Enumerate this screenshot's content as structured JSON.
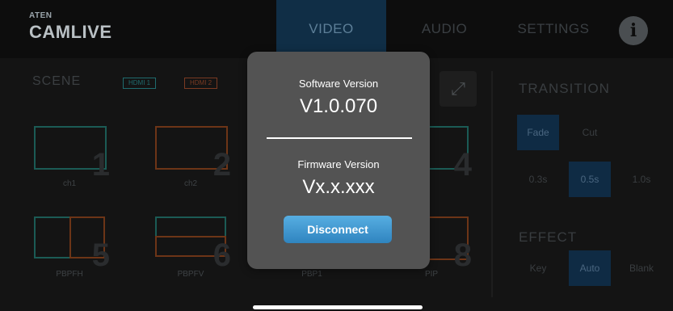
{
  "brand": {
    "top": "ATEN",
    "name": "CAMLIVE"
  },
  "tabs": {
    "video": "VIDEO",
    "audio": "AUDIO",
    "settings": "SETTINGS"
  },
  "info_glyph": "i",
  "scene": {
    "title": "SCENE",
    "hdmi1": "HDMI 1",
    "hdmi2": "HDMI 2",
    "expand_glyph": "⤢",
    "cells": [
      {
        "number": "1",
        "label": "ch1"
      },
      {
        "number": "2",
        "label": "ch2"
      },
      {
        "number": "4",
        "label": ""
      },
      {
        "number": "5",
        "label": "PBPFH"
      },
      {
        "number": "6",
        "label": "PBPFV"
      },
      {
        "number": "",
        "label": "PBP1"
      },
      {
        "number": "8",
        "label": "PIP"
      }
    ]
  },
  "transition": {
    "title": "TRANSITION",
    "types": [
      "Fade",
      "Cut"
    ],
    "active_type": "Fade",
    "durations": [
      "0.3s",
      "0.5s",
      "1.0s"
    ],
    "active_duration": "0.5s"
  },
  "effect": {
    "title": "EFFECT",
    "options": [
      "Key",
      "Auto",
      "Blank"
    ],
    "active_option": "Auto"
  },
  "dialog": {
    "software_label": "Software Version",
    "software_value": "V1.0.070",
    "firmware_label": "Firmware Version",
    "firmware_value": "Vx.x.xxx",
    "disconnect_label": "Disconnect"
  }
}
